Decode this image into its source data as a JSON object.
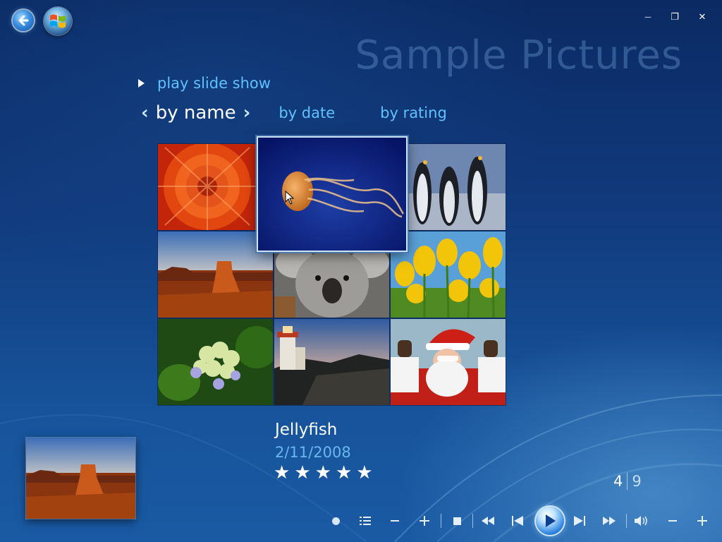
{
  "window": {
    "title": "Sample Pictures",
    "minimize_glyph": "—",
    "restore_glyph": "❐",
    "close_glyph": "✕"
  },
  "nav": {
    "back_icon": "back-arrow-icon",
    "start_icon": "windows-orb-icon"
  },
  "actions": {
    "play_slideshow": "play slide show"
  },
  "sort": {
    "active": "by name",
    "prev_glyph": "‹",
    "next_glyph": "›",
    "options": [
      "by date",
      "by rating"
    ]
  },
  "gallery": {
    "items": [
      {
        "id": "chrysanthemum",
        "icon": "flower-photo"
      },
      {
        "id": "jellyfish",
        "icon": "jellyfish-photo"
      },
      {
        "id": "penguins",
        "icon": "penguins-photo"
      },
      {
        "id": "desert",
        "icon": "desert-photo"
      },
      {
        "id": "koala",
        "icon": "koala-photo"
      },
      {
        "id": "tulips",
        "icon": "tulips-photo"
      },
      {
        "id": "hydrangeas",
        "icon": "hydrangeas-photo"
      },
      {
        "id": "lighthouse",
        "icon": "lighthouse-photo"
      },
      {
        "id": "santa",
        "icon": "santa-photo"
      }
    ],
    "focused_index": 1
  },
  "selected": {
    "name": "Jellyfish",
    "date": "2/11/2008",
    "rating": 5,
    "star_glyph": "★"
  },
  "pager": {
    "current": "4",
    "total": "9"
  },
  "transport": {
    "icons": [
      "record-icon",
      "list-icon",
      "minus-icon",
      "plus-icon",
      "stop-icon",
      "rewind-icon",
      "previous-track-icon",
      "play-icon",
      "next-track-icon",
      "fast-forward-icon",
      "volume-icon",
      "volume-down-icon",
      "volume-up-icon"
    ]
  },
  "colors": {
    "accent_text": "#5fc2ff",
    "background_top": "#0b2a63",
    "background_bottom": "#1a5aa4"
  }
}
